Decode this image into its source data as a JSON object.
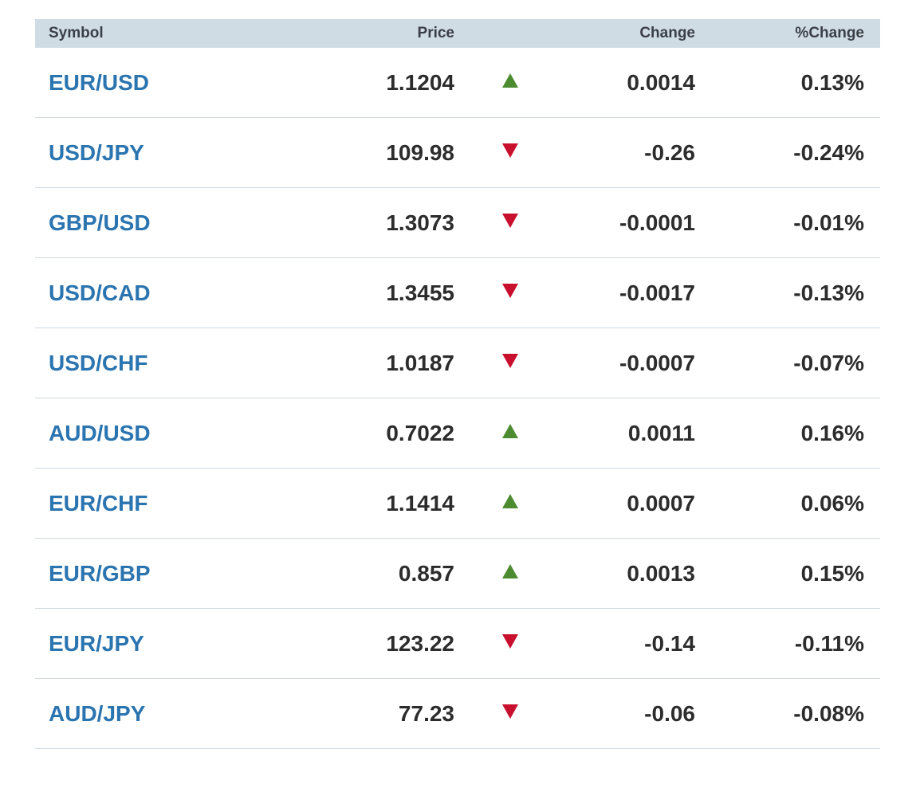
{
  "header": {
    "symbol": "Symbol",
    "price": "Price",
    "change": "Change",
    "pct_change": "%Change"
  },
  "colors": {
    "up": "#4d8b31",
    "down": "#c8102e",
    "symbol_link": "#2a74b0",
    "header_bg": "#d0dce4"
  },
  "rows": [
    {
      "symbol": "EUR/USD",
      "price": "1.1204",
      "direction": "up",
      "change": "0.0014",
      "pct_change": "0.13%"
    },
    {
      "symbol": "USD/JPY",
      "price": "109.98",
      "direction": "down",
      "change": "-0.26",
      "pct_change": "-0.24%"
    },
    {
      "symbol": "GBP/USD",
      "price": "1.3073",
      "direction": "down",
      "change": "-0.0001",
      "pct_change": "-0.01%"
    },
    {
      "symbol": "USD/CAD",
      "price": "1.3455",
      "direction": "down",
      "change": "-0.0017",
      "pct_change": "-0.13%"
    },
    {
      "symbol": "USD/CHF",
      "price": "1.0187",
      "direction": "down",
      "change": "-0.0007",
      "pct_change": "-0.07%"
    },
    {
      "symbol": "AUD/USD",
      "price": "0.7022",
      "direction": "up",
      "change": "0.0011",
      "pct_change": "0.16%"
    },
    {
      "symbol": "EUR/CHF",
      "price": "1.1414",
      "direction": "up",
      "change": "0.0007",
      "pct_change": "0.06%"
    },
    {
      "symbol": "EUR/GBP",
      "price": "0.857",
      "direction": "up",
      "change": "0.0013",
      "pct_change": "0.15%"
    },
    {
      "symbol": "EUR/JPY",
      "price": "123.22",
      "direction": "down",
      "change": "-0.14",
      "pct_change": "-0.11%"
    },
    {
      "symbol": "AUD/JPY",
      "price": "77.23",
      "direction": "down",
      "change": "-0.06",
      "pct_change": "-0.08%"
    }
  ]
}
